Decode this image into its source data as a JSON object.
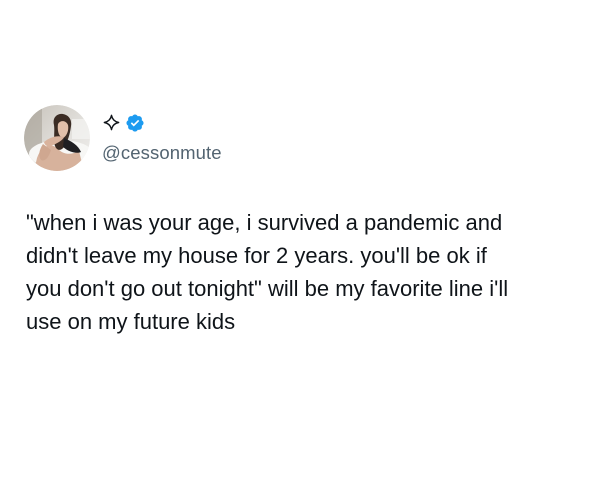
{
  "tweet": {
    "author": {
      "avatar_icon": "profile-photo",
      "display_name_icon": "sparkle-icon",
      "badge_icon": "verified-badge-icon",
      "badge_color": "#1d9bf0",
      "handle": "@cessonmute"
    },
    "text": "\"when i was your age, i survived a pandemic and\ndidn't leave my house for 2 years. you'll be ok if\nyou don't go out tonight\" will be my favorite line i'll\nuse on my future kids"
  }
}
